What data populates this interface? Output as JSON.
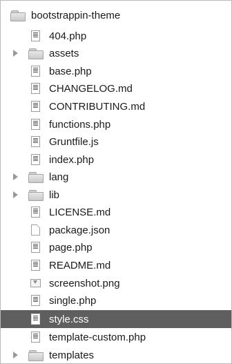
{
  "tree": {
    "root": {
      "label": "bootstrappin-theme",
      "icon": "folder-icon"
    },
    "items": [
      {
        "label": "404.php",
        "icon": "document-icon"
      },
      {
        "label": "assets",
        "icon": "folder-icon",
        "collapsed": true
      },
      {
        "label": "base.php",
        "icon": "document-icon"
      },
      {
        "label": "CHANGELOG.md",
        "icon": "document-icon"
      },
      {
        "label": "CONTRIBUTING.md",
        "icon": "document-icon"
      },
      {
        "label": "functions.php",
        "icon": "document-icon"
      },
      {
        "label": "Gruntfile.js",
        "icon": "document-icon"
      },
      {
        "label": "index.php",
        "icon": "document-icon"
      },
      {
        "label": "lang",
        "icon": "folder-icon",
        "collapsed": true
      },
      {
        "label": "lib",
        "icon": "folder-icon",
        "collapsed": true
      },
      {
        "label": "LICENSE.md",
        "icon": "document-icon"
      },
      {
        "label": "package.json",
        "icon": "plain-file-icon"
      },
      {
        "label": "page.php",
        "icon": "document-icon"
      },
      {
        "label": "README.md",
        "icon": "document-icon"
      },
      {
        "label": "screenshot.png",
        "icon": "image-file-icon"
      },
      {
        "label": "single.php",
        "icon": "document-icon"
      },
      {
        "label": "style.css",
        "icon": "document-icon",
        "selected": true
      },
      {
        "label": "template-custom.php",
        "icon": "document-icon"
      },
      {
        "label": "templates",
        "icon": "folder-icon",
        "collapsed": true
      }
    ]
  },
  "colors": {
    "selection": "#5f5f5f",
    "border": "#b9b9b9"
  }
}
